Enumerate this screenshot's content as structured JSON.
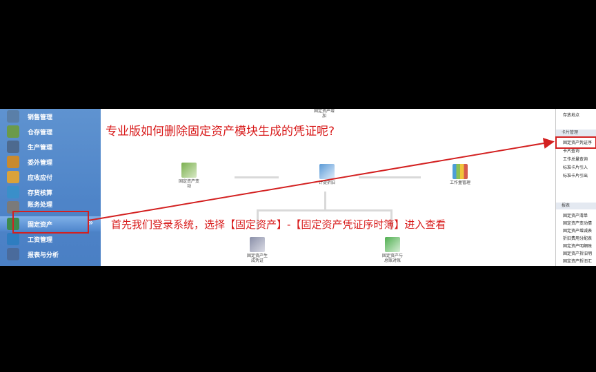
{
  "sidebar": {
    "items": [
      {
        "label": "销售管理",
        "color": "#5a7fa8"
      },
      {
        "label": "仓存管理",
        "color": "#6b9a4a"
      },
      {
        "label": "生产管理",
        "color": "#4d6a8f"
      },
      {
        "label": "委外管理",
        "color": "#c98a2e"
      },
      {
        "label": "应收应付",
        "color": "#d9a23a"
      },
      {
        "label": "存货核算",
        "color": "#3a8fc9"
      },
      {
        "label": "账务处理",
        "color": "#7a7a7a"
      },
      {
        "label": "固定资产",
        "color": "#3d8a4e"
      },
      {
        "label": "工资管理",
        "color": "#2e7dc0"
      },
      {
        "label": "报表与分析",
        "color": "#4a6b9c"
      }
    ],
    "active_index": 7,
    "expand_glyph": "»"
  },
  "workflow": {
    "nodes": {
      "top": "固定资产增\n加",
      "change": "固定资产变\n动",
      "depreciation": "计提折旧",
      "workload": "工作量管理",
      "voucher": "固定资产生\n成凭证",
      "ledger": "固定资产与\n总账对账"
    }
  },
  "right_panel": {
    "top_item": "存放地点",
    "card_section": "卡片管理",
    "card_items": [
      "固定资产凭证序",
      "卡片查询",
      "工作总量查询",
      "标准卡片引入",
      "标准卡片引出"
    ],
    "report_section": "报表",
    "report_items": [
      "固定资产清单",
      "固定资产变动情",
      "固定资产增减表",
      "折旧费用分配表",
      "固定资产明细账",
      "固定资产折旧明",
      "固定资产折旧汇"
    ]
  },
  "overlay": {
    "title": "专业版如何删除固定资产模块生成的凭证呢?",
    "instruction": "首先我们登录系统，选择【固定资产】-【固定资产凭证序时簿】进入查看",
    "accent_color": "#d81b1b"
  }
}
